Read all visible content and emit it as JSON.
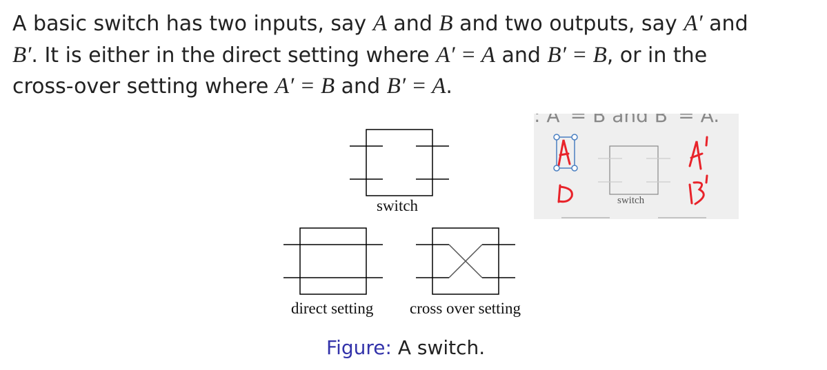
{
  "paragraph": {
    "t1": "A basic switch has two inputs, say ",
    "A": "A",
    "t2": " and ",
    "B": "B",
    "t3": " and two outputs, say ",
    "Ap": "A′",
    "t4": " and",
    "Bp": "B′",
    "t5": ". It is either in the direct setting where ",
    "eq1": "A′ = A",
    "t6": " and ",
    "eq2": "B′ = B",
    "t7": ", or in the",
    "t8": "cross-over setting where ",
    "eq3": "A′ = B",
    "t9": " and ",
    "eq4": "B′ = A",
    "t10": "."
  },
  "figure": {
    "switch_label": "switch",
    "direct_label": "direct setting",
    "cross_label": "cross over setting",
    "caption_prefix": "Figure:",
    "caption_text": " A switch."
  },
  "inset": {
    "top_text": ": A′ = B and B′ = A.",
    "switch_label": "switch",
    "annotations": [
      "A",
      "B",
      "A'",
      "B'"
    ],
    "annotation_color": "#e8232a",
    "selection_color": "#4a7fc1"
  }
}
